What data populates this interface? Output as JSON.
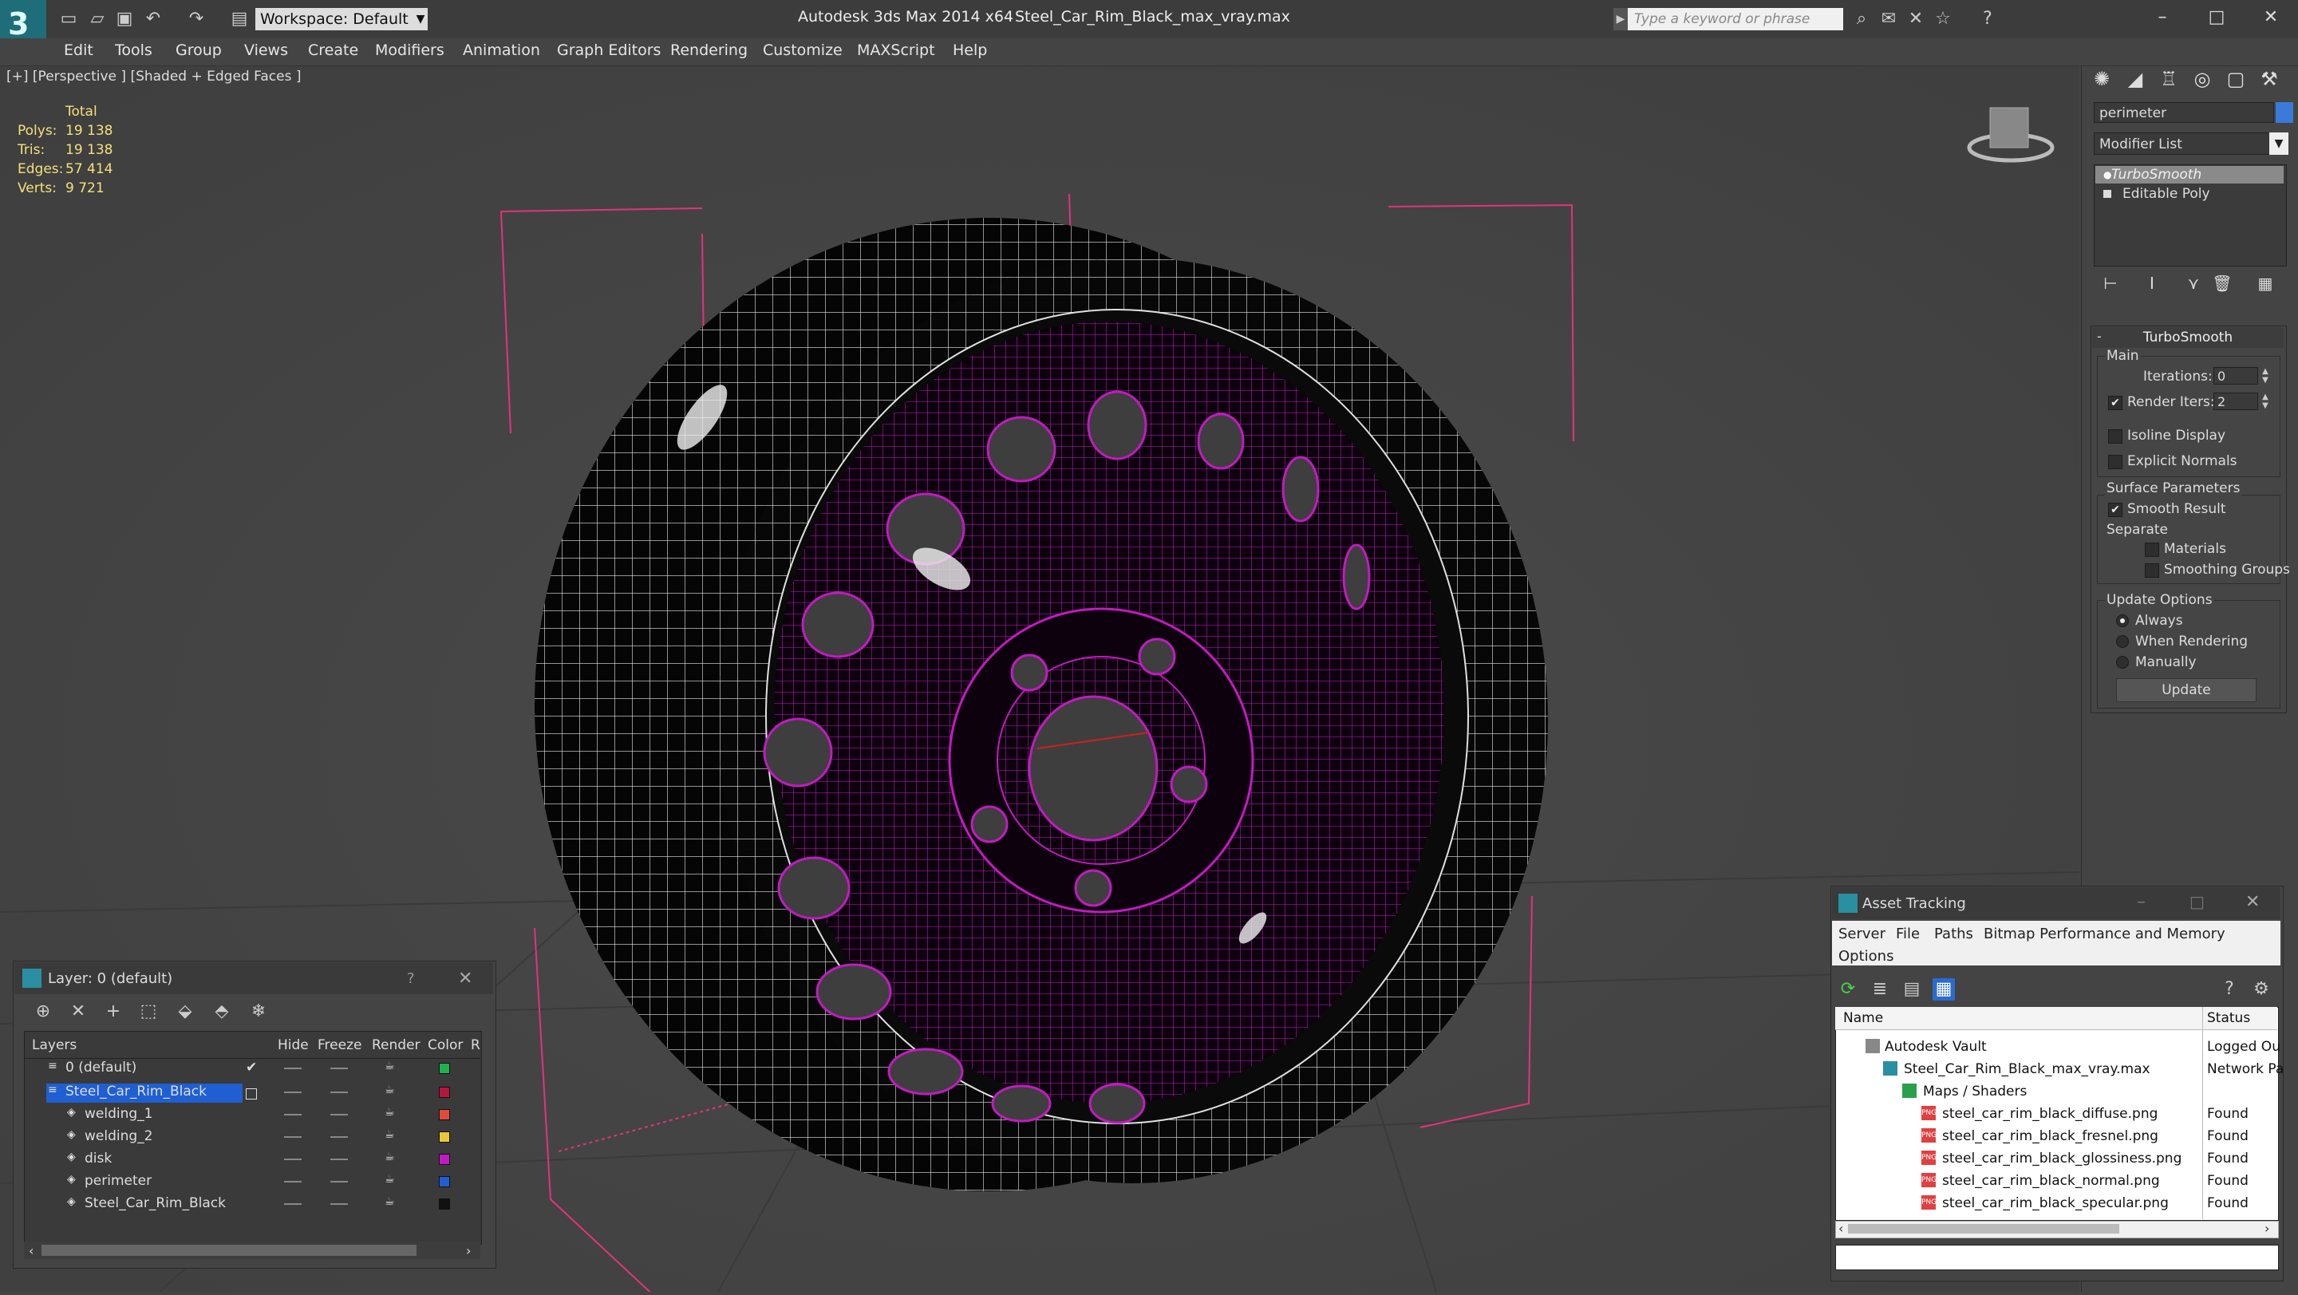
{
  "app": {
    "title": "Autodesk 3ds Max  2014 x64",
    "file": "Steel_Car_Rim_Black_max_vray.max",
    "workspace": "Workspace: Default",
    "search_placeholder": "Type a keyword or phrase"
  },
  "menu": [
    "Edit",
    "Tools",
    "Group",
    "Views",
    "Create",
    "Modifiers",
    "Animation",
    "Graph Editors",
    "Rendering",
    "Customize",
    "MAXScript",
    "Help"
  ],
  "viewport": {
    "label": "[+] [Perspective ] [Shaded + Edged Faces ]",
    "stats": {
      "header": "Total",
      "rows": [
        {
          "label": "Polys:",
          "value": "19 138"
        },
        {
          "label": "Tris:",
          "value": "19 138"
        },
        {
          "label": "Edges:",
          "value": "57 414"
        },
        {
          "label": "Verts:",
          "value": "9 721"
        }
      ]
    }
  },
  "command_panel": {
    "object_name": "perimeter",
    "modifier_list": "Modifier List",
    "stack": [
      "TurboSmooth",
      "Editable Poly"
    ],
    "rollout_title": "TurboSmooth",
    "main_group": "Main",
    "iterations_label": "Iterations:",
    "iterations_value": "0",
    "render_iters_label": "Render Iters:",
    "render_iters_value": "2",
    "isoline": "Isoline Display",
    "explicit_normals": "Explicit Normals",
    "surface_group": "Surface Parameters",
    "smooth_result": "Smooth Result",
    "separate": "Separate",
    "materials": "Materials",
    "smoothing_groups": "Smoothing Groups",
    "update_group": "Update Options",
    "always": "Always",
    "when_rendering": "When Rendering",
    "manually": "Manually",
    "update": "Update"
  },
  "layers_panel": {
    "title": "Layer: 0 (default)",
    "help": "?",
    "headers": {
      "layers": "Layers",
      "hide": "Hide",
      "freeze": "Freeze",
      "render": "Render",
      "color": "Color",
      "r": "R"
    },
    "rows": [
      {
        "name": "0 (default)",
        "color": "#22b14c"
      },
      {
        "name": "Steel_Car_Rim_Black",
        "color": "#b5163c"
      },
      {
        "name": "welding_1",
        "color": "#e04c3c"
      },
      {
        "name": "welding_2",
        "color": "#e8c63a"
      },
      {
        "name": "disk",
        "color": "#c21ac2"
      },
      {
        "name": "perimeter",
        "color": "#1f5fd1"
      },
      {
        "name": "Steel_Car_Rim_Black",
        "color": "#111111"
      }
    ]
  },
  "asset_panel": {
    "title": "Asset Tracking",
    "menu": [
      "Server",
      "File",
      "Paths",
      "Bitmap Performance and Memory",
      "Options"
    ],
    "headers": {
      "name": "Name",
      "status": "Status"
    },
    "rows": [
      {
        "name": "Autodesk Vault",
        "status": "Logged Ou"
      },
      {
        "name": "Steel_Car_Rim_Black_max_vray.max",
        "status": "Network Pa"
      },
      {
        "name": "Maps / Shaders",
        "status": ""
      },
      {
        "name": "steel_car_rim_black_diffuse.png",
        "status": "Found"
      },
      {
        "name": "steel_car_rim_black_fresnel.png",
        "status": "Found"
      },
      {
        "name": "steel_car_rim_black_glossiness.png",
        "status": "Found"
      },
      {
        "name": "steel_car_rim_black_normal.png",
        "status": "Found"
      },
      {
        "name": "steel_car_rim_black_specular.png",
        "status": "Found"
      }
    ]
  },
  "colors": {
    "accent": "#1f5fd1",
    "wire_pink": "#c21ac2",
    "stats_yellow": "#f5e07a"
  }
}
